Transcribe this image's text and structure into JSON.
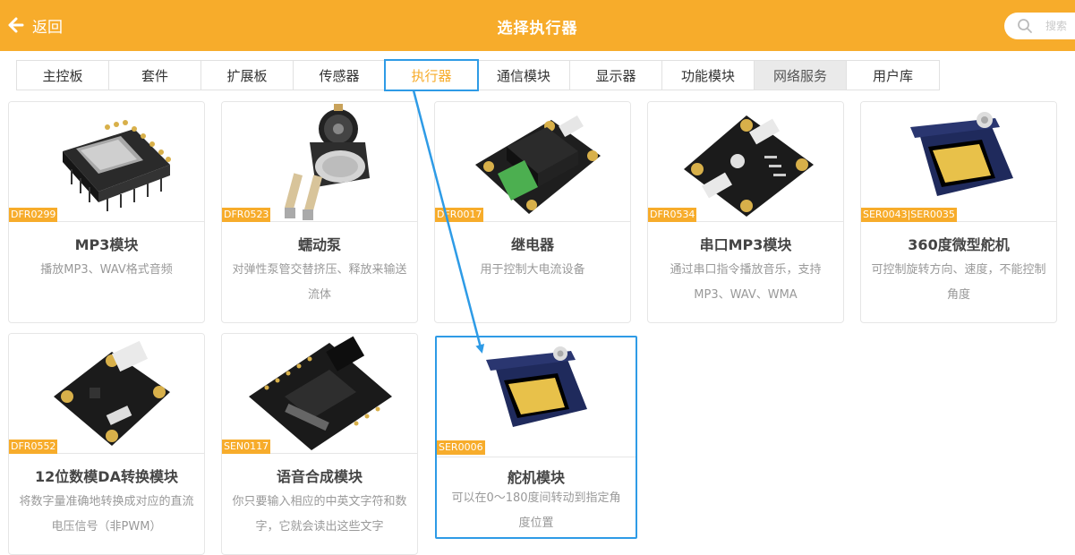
{
  "header": {
    "back_label": "返回",
    "title": "选择执行器",
    "search_placeholder": "搜索"
  },
  "tabs": [
    {
      "label": "主控板"
    },
    {
      "label": "套件"
    },
    {
      "label": "扩展板"
    },
    {
      "label": "传感器"
    },
    {
      "label": "执行器"
    },
    {
      "label": "通信模块"
    },
    {
      "label": "显示器"
    },
    {
      "label": "功能模块"
    },
    {
      "label": "网络服务"
    },
    {
      "label": "用户库"
    }
  ],
  "products": [
    {
      "sku": "DFR0299",
      "name": "MP3模块",
      "desc": "播放MP3、WAV格式音频",
      "icon": "mp3-module-image"
    },
    {
      "sku": "DFR0523",
      "name": "蠕动泵",
      "desc": "对弹性泵管交替挤压、释放来输送流体",
      "icon": "peristaltic-pump-image"
    },
    {
      "sku": "DFR0017",
      "name": "继电器",
      "desc": "用于控制大电流设备",
      "icon": "relay-image"
    },
    {
      "sku": "DFR0534",
      "name": "串口MP3模块",
      "desc": "通过串口指令播放音乐，支持MP3、WAV、WMA",
      "icon": "serial-mp3-image"
    },
    {
      "sku": "SER0043|SER0035",
      "name": "360度微型舵机",
      "desc": "可控制旋转方向、速度，不能控制角度",
      "icon": "servo-360-image"
    },
    {
      "sku": "DFR0552",
      "name": "12位数模DA转换模块",
      "desc": "将数字量准确地转换成对应的直流电压信号（非PWM）",
      "icon": "dac-module-image"
    },
    {
      "sku": "SEN0117",
      "name": "语音合成模块",
      "desc": "你只要输入相应的中英文字符和数字，它就会读出这些文字",
      "icon": "speech-synth-image"
    },
    {
      "sku": "SER0006",
      "name": "舵机模块",
      "desc": "可以在0～180度间转动到指定角度位置",
      "icon": "servo-image"
    }
  ],
  "colors": {
    "accent": "#f7ac2b",
    "highlight": "#2e9be6"
  }
}
